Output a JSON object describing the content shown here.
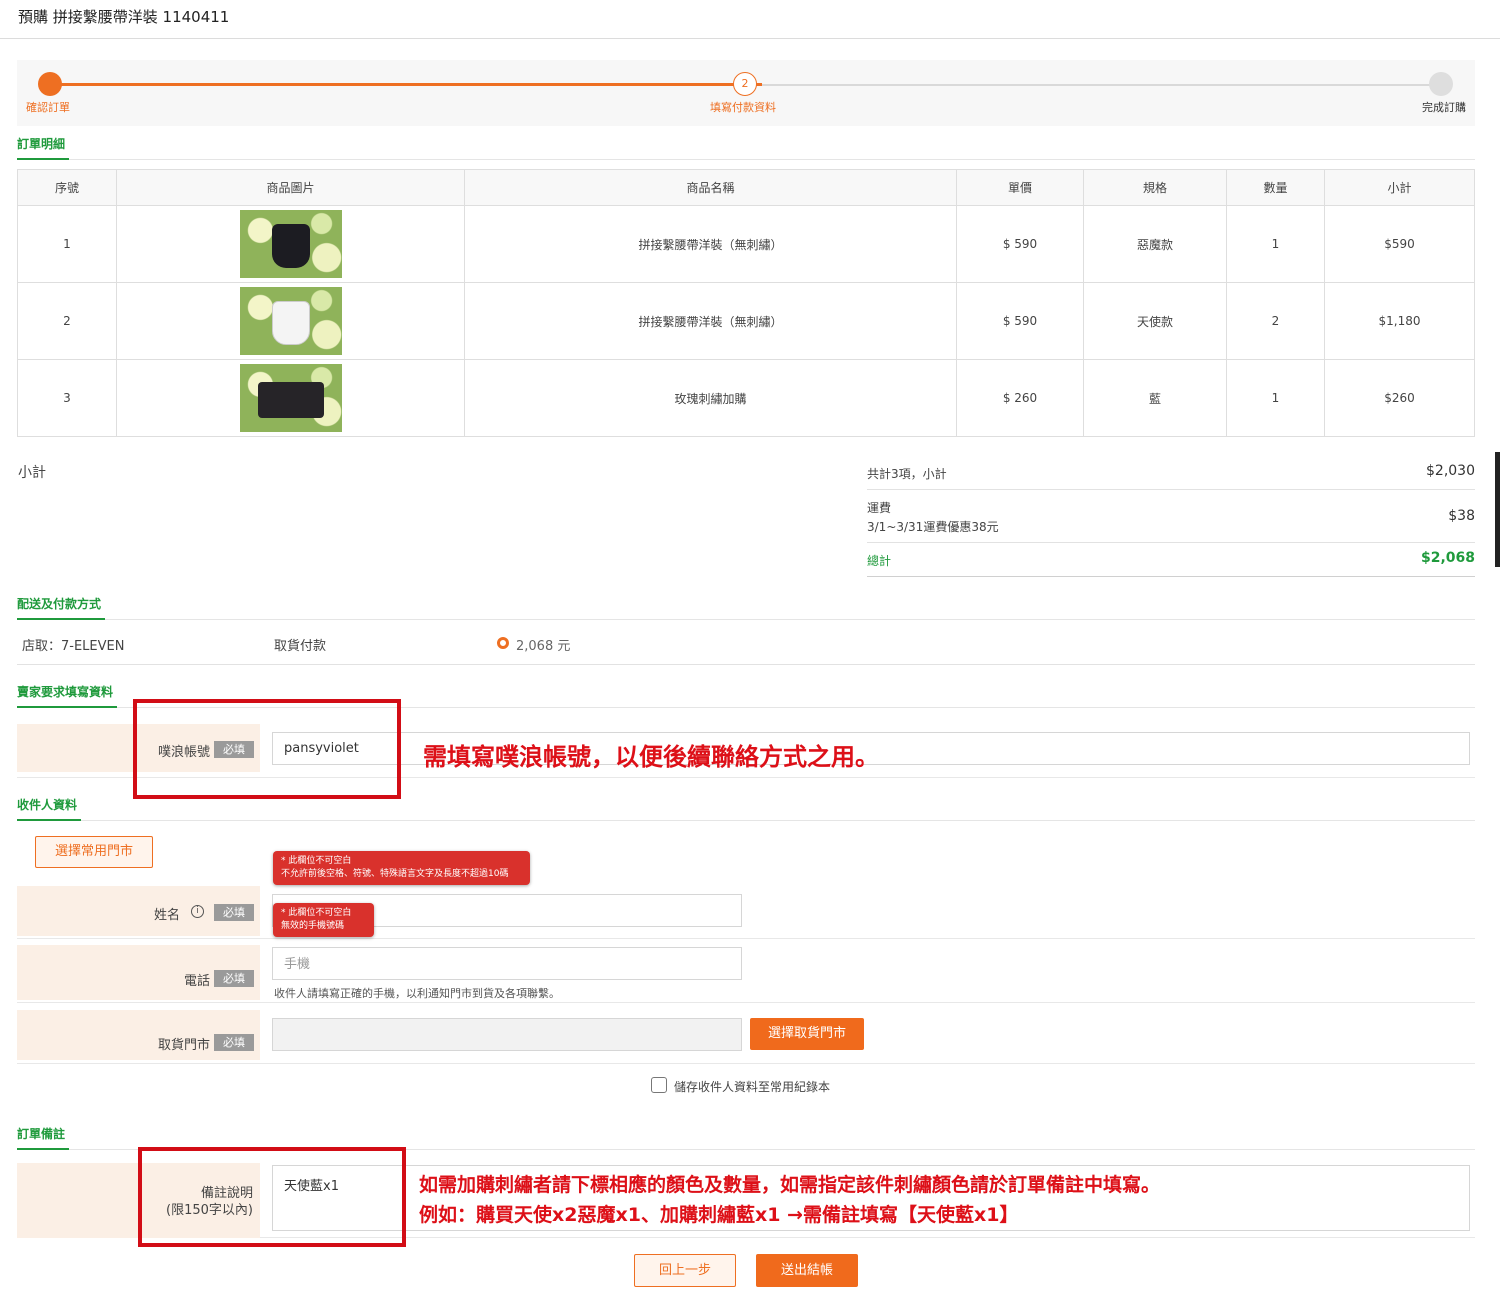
{
  "page": {
    "title": "預購 拼接繫腰帶洋裝 1140411"
  },
  "steps": [
    {
      "label": "確認訂單"
    },
    {
      "label": "填寫付款資料",
      "number": "2"
    },
    {
      "label": "完成訂購"
    }
  ],
  "sections": {
    "order_detail": "訂單明細",
    "shipping": "配送及付款方式",
    "seller_required": "賣家要求填寫資料",
    "recipient": "收件人資料",
    "order_note": "訂單備註"
  },
  "table": {
    "headers": [
      "序號",
      "商品圖片",
      "商品名稱",
      "單價",
      "規格",
      "數量",
      "小計"
    ],
    "rows": [
      {
        "no": "1",
        "name": "拼接繫腰帶洋裝（無刺繡）",
        "price": "$ 590",
        "spec": "惡魔款",
        "qty": "1",
        "subtotal": "$590"
      },
      {
        "no": "2",
        "name": "拼接繫腰帶洋裝（無刺繡）",
        "price": "$ 590",
        "spec": "天使款",
        "qty": "2",
        "subtotal": "$1,180"
      },
      {
        "no": "3",
        "name": "玫瑰刺繡加購",
        "price": "$ 260",
        "spec": "藍",
        "qty": "1",
        "subtotal": "$260"
      }
    ]
  },
  "summary": {
    "label": "小計",
    "items_label": "共計3項，小計",
    "items_value": "$2,030",
    "shipping_label": "運費",
    "shipping_note": "3/1~3/31運費優惠38元",
    "shipping_value": "$38",
    "total_label": "總計",
    "total_value": "$2,068"
  },
  "shipping": {
    "method": "店取：7-ELEVEN",
    "payment": "取貨付款",
    "amount": "2,068 元"
  },
  "seller_form": {
    "plurk_label": "噗浪帳號",
    "plurk_value": "pansyviolet",
    "required": "必填"
  },
  "recipient": {
    "select_store_button": "選擇常用門市",
    "name_label": "姓名",
    "phone_label": "電話",
    "phone_placeholder": "手機",
    "phone_hint": "收件人請填寫正確的手機，以利通知門市到貨及各項聯繫。",
    "store_label": "取貨門市",
    "choose_store_button": "選擇取貨門市",
    "required": "必填",
    "tip_name_1": "* 此欄位不可空白",
    "tip_name_2": "不允許前後空格、符號、特殊語言文字及長度不超過10碼",
    "tip_phone_1": "* 此欄位不可空白",
    "tip_phone_2": "無效的手機號碼",
    "save_label": "儲存收件人資料至常用紀錄本"
  },
  "note": {
    "label_line1": "備註說明",
    "label_line2": "(限150字以內)",
    "value": "天使藍x1"
  },
  "buttons": {
    "back": "回上一步",
    "checkout": "送出結帳"
  },
  "annotations": {
    "plurk": "需填寫噗浪帳號，以便後續聯絡方式之用。",
    "note_line1": "如需加購刺繡者請下標相應的顏色及數量，如需指定該件刺繡顏色請於訂單備註中填寫。",
    "note_line2": "例如：購買天使x2惡魔x1、加購刺繡藍x1 →需備註填寫【天使藍x1】"
  },
  "colors": {
    "accent": "#ee6f22",
    "green": "#1f9a3c",
    "annotation_red": "#d20d16"
  }
}
